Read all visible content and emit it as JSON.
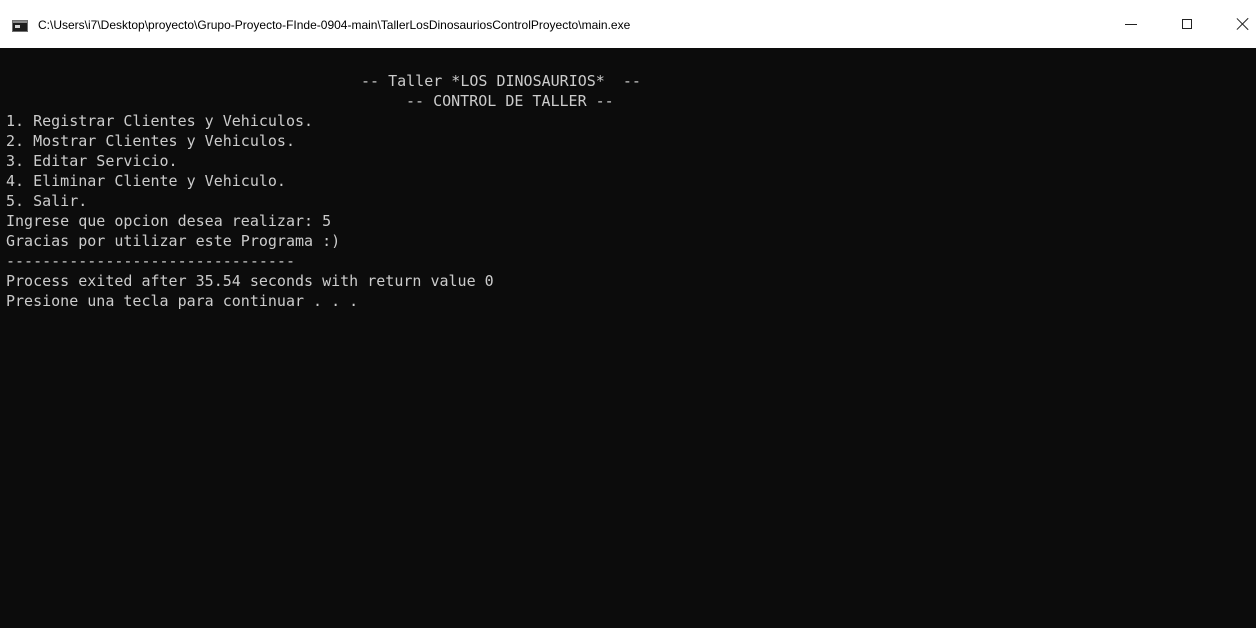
{
  "window": {
    "title": "C:\\Users\\i7\\Desktop\\proyecto\\Grupo-Proyecto-FInde-0904-main\\TallerLosDinosauriosControlProyecto\\main.exe"
  },
  "console": {
    "header_line_1": "-- Taller *LOS DINOSAURIOS*  --",
    "header_line_2": "-- CONTROL DE TALLER --",
    "menu_options": [
      "1. Registrar Clientes y Vehiculos.",
      "2. Mostrar Clientes y Vehiculos.",
      "3. Editar Servicio.",
      "4. Eliminar Cliente y Vehiculo.",
      "5. Salir."
    ],
    "prompt": "Ingrese que opcion desea realizar: 5",
    "goodbye": "Gracias por utilizar este Programa :)",
    "separator": "--------------------------------",
    "process_exit": "Process exited after 35.54 seconds with return value 0",
    "press_key": "Presione una tecla para continuar . . ."
  },
  "colors": {
    "console_background": "#0c0c0c",
    "console_text": "#cccccc",
    "titlebar_background": "#ffffff"
  },
  "icons": {
    "app": "console-app-icon",
    "minimize": "minimize-icon",
    "maximize": "maximize-icon",
    "close": "close-icon"
  }
}
